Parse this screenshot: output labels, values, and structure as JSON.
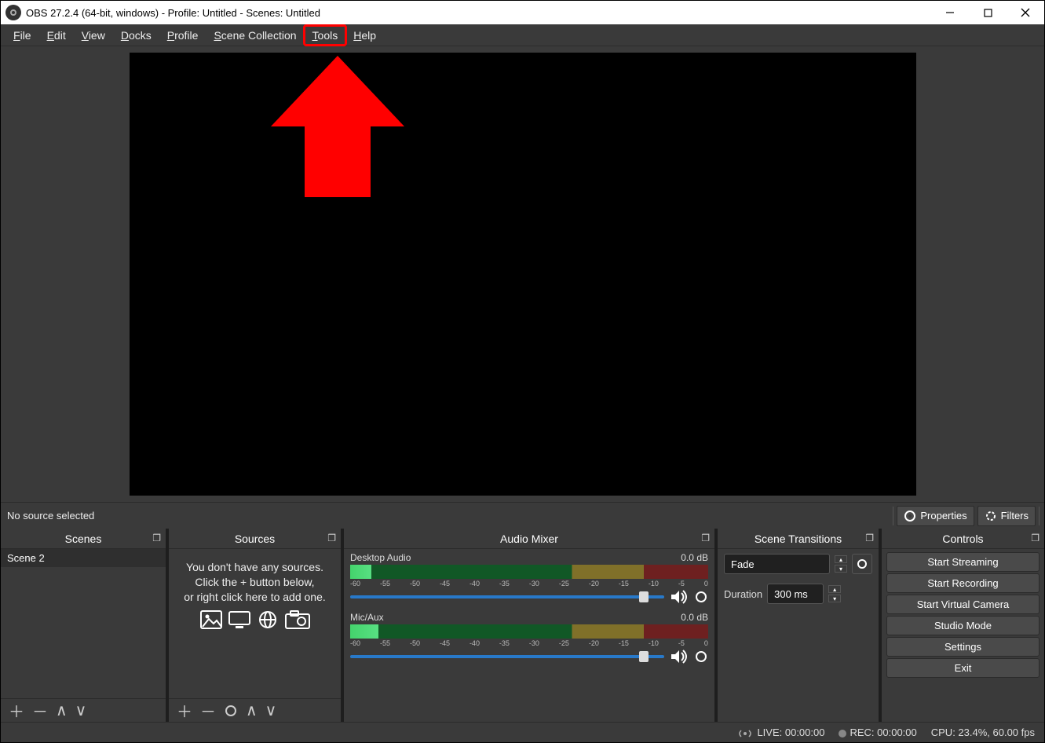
{
  "titlebar": {
    "title": "OBS 27.2.4 (64-bit, windows) - Profile: Untitled - Scenes: Untitled"
  },
  "menu": {
    "file": "File",
    "edit": "Edit",
    "view": "View",
    "docks": "Docks",
    "profile": "Profile",
    "scene_collection": "Scene Collection",
    "tools": "Tools",
    "help": "Help"
  },
  "source_toolbar": {
    "no_source": "No source selected",
    "properties": "Properties",
    "filters": "Filters"
  },
  "docks": {
    "scenes": "Scenes",
    "sources": "Sources",
    "mixer": "Audio Mixer",
    "transitions": "Scene Transitions",
    "controls": "Controls"
  },
  "scenes": {
    "items": [
      "Scene 2"
    ]
  },
  "sources": {
    "hint1": "You don't have any sources.",
    "hint2": "Click the + button below,",
    "hint3": "or right click here to add one."
  },
  "mixer": {
    "ticks": [
      "-60",
      "-55",
      "-50",
      "-45",
      "-40",
      "-35",
      "-30",
      "-25",
      "-20",
      "-15",
      "-10",
      "-5",
      "0"
    ],
    "channels": [
      {
        "name": "Desktop Audio",
        "level": "0.0 dB"
      },
      {
        "name": "Mic/Aux",
        "level": "0.0 dB"
      }
    ]
  },
  "transitions": {
    "selected": "Fade",
    "duration_label": "Duration",
    "duration_value": "300 ms"
  },
  "controls": {
    "start_streaming": "Start Streaming",
    "start_recording": "Start Recording",
    "start_virtual_cam": "Start Virtual Camera",
    "studio_mode": "Studio Mode",
    "settings": "Settings",
    "exit": "Exit"
  },
  "status": {
    "live": "LIVE: 00:00:00",
    "rec": "REC: 00:00:00",
    "cpu": "CPU: 23.4%, 60.00 fps"
  },
  "annotation": {
    "highlight_menu": "tools"
  }
}
